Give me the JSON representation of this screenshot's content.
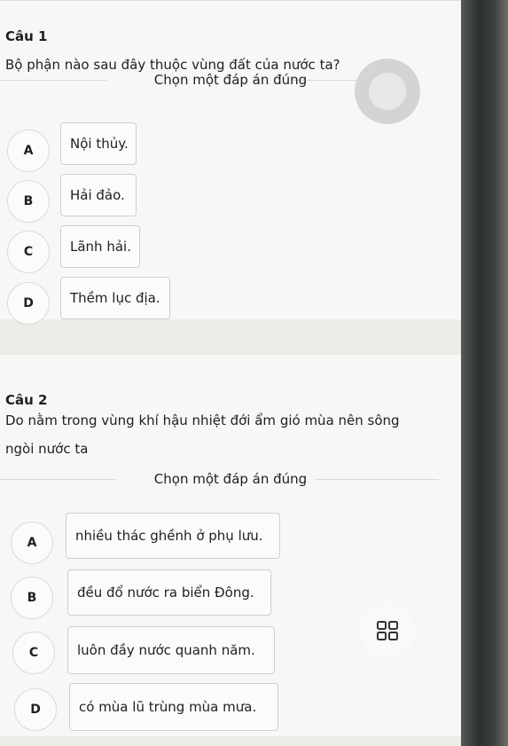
{
  "questions": [
    {
      "title": "Câu 1",
      "text": "Bộ phận nào sau đây thuộc vùng đất của nước ta?",
      "instruction": "Chọn một đáp án đúng",
      "options": [
        {
          "letter": "A",
          "text": "Nội thủy."
        },
        {
          "letter": "B",
          "text": "Hải đảo."
        },
        {
          "letter": "C",
          "text": "Lãnh hải."
        },
        {
          "letter": "D",
          "text": "Thềm lục địa."
        }
      ]
    },
    {
      "title": "Câu 2",
      "text_line1": "Do nằm trong vùng khí hậu nhiệt đới ẩm gió mùa nên sông",
      "text_line2": "ngòi nước ta",
      "instruction": "Chọn một đáp án đúng",
      "options": [
        {
          "letter": "A",
          "text": "nhiều thác ghềnh ở phụ lưu."
        },
        {
          "letter": "B",
          "text": "đều đổ nước ra biển Đông."
        },
        {
          "letter": "C",
          "text": "luôn đầy nước quanh năm."
        },
        {
          "letter": "D",
          "text": "có mùa lũ trùng mùa mưa."
        }
      ]
    }
  ],
  "icons": {
    "timer": "timer-icon",
    "grid": "grid-icon"
  }
}
